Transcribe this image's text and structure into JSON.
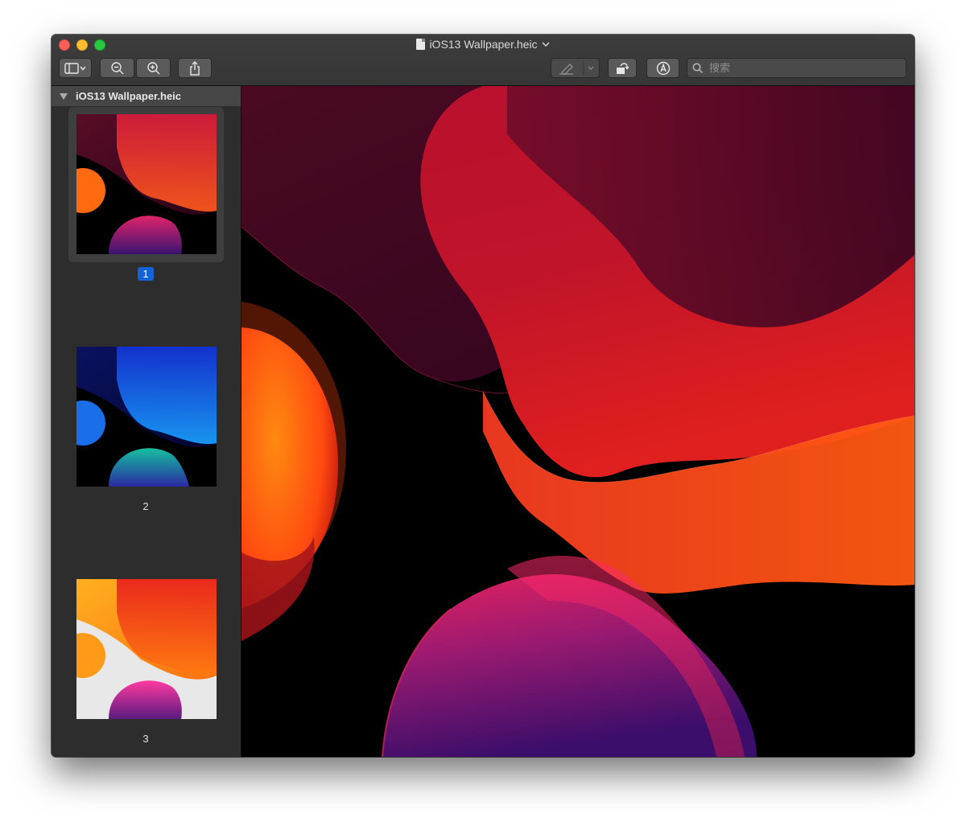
{
  "window": {
    "title": "iOS13 Wallpaper.heic"
  },
  "toolbar": {
    "buttons": [
      {
        "icon": "sidebar-icon"
      },
      {
        "icon": "zoom-out-icon"
      },
      {
        "icon": "zoom-in-icon"
      },
      {
        "icon": "share-icon"
      },
      {
        "icon": "highlight-icon"
      },
      {
        "icon": "rotate-icon"
      },
      {
        "icon": "markup-icon"
      }
    ],
    "search_placeholder": "搜索"
  },
  "sidebar": {
    "header": "iOS13 Wallpaper.heic",
    "pages": [
      {
        "label": "1",
        "selected": true
      },
      {
        "label": "2",
        "selected": false
      },
      {
        "label": "3",
        "selected": false
      }
    ]
  },
  "colors": {
    "selection": "#1463d6",
    "traffic_close": "#fe5f57",
    "traffic_min": "#febc2e",
    "traffic_max": "#28c840"
  }
}
